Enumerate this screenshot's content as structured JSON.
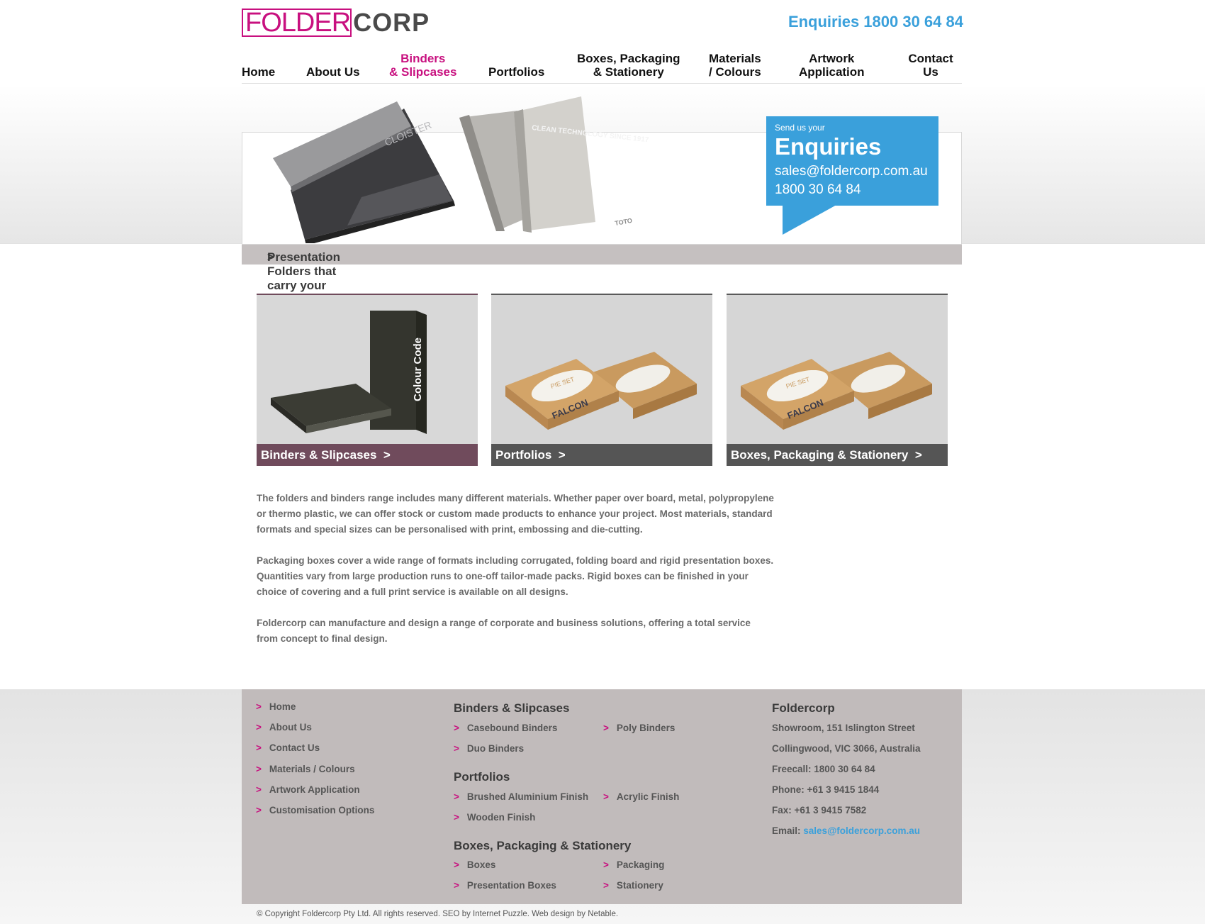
{
  "header": {
    "logo_part1": "FOLDER",
    "logo_part2": "CORP",
    "enquiries": "Enquiries 1800 30 64 84"
  },
  "nav": {
    "home": "Home",
    "about": "About Us",
    "binders_l1": "Binders",
    "binders_l2": "& Slipcases",
    "portfolios": "Portfolios",
    "boxes_l1": "Boxes, Packaging",
    "boxes_l2": "& Stationery",
    "materials_l1": "Materials",
    "materials_l2": "/ Colours",
    "artwork_l1": "Artwork",
    "artwork_l2": "Application",
    "contact": "Contact Us"
  },
  "hero": {
    "enq_small": "Send us your",
    "enq_big": "Enquiries",
    "enq_email": "sales@foldercorp.com.au",
    "enq_phone": "1800 30 64 84",
    "bar_text": "Presentation Folders that carry your corporate brand and style creating the right impression",
    "binder_text": "CLEAN TECHNOLOGY SINCE 1917",
    "binder_brand": "TOTO",
    "folder_brand": "CLOISTER"
  },
  "cards": [
    {
      "label": "Binders & Slipcases",
      "color": "#704b5c",
      "spine_text": "Colour Code"
    },
    {
      "label": "Portfolios",
      "color": "#555555",
      "box_text": "FALCON",
      "lid_text": "PIE SET"
    },
    {
      "label": "Boxes, Packaging & Stationery",
      "color": "#555555",
      "box_text": "FALCON",
      "lid_text": "PIE SET"
    }
  ],
  "body": {
    "p1": "The folders and binders range includes many different materials. Whether paper over board, metal, polypropylene or thermo plastic, we can offer stock or custom made products to enhance your project. Most materials, standard formats and special sizes can be personalised with print, embossing and die-cutting.",
    "p2": "Packaging boxes cover a wide range of formats including corrugated, folding board and rigid presentation boxes. Quantities vary from large production runs to one-off tailor-made packs. Rigid boxes can be finished in your choice of covering and a full print service is available on all designs.",
    "p3": "Foldercorp can manufacture and design a range of corporate and business solutions, offering a total service from concept to final design."
  },
  "footer": {
    "links": [
      "Home",
      "About Us",
      "Contact Us",
      "Materials / Colours",
      "Artwork Application",
      "Customisation Options"
    ],
    "binders_head": "Binders & Slipcases",
    "binders": [
      "Casebound Binders",
      "Poly Binders",
      "Duo Binders"
    ],
    "portfolios_head": "Portfolios",
    "portfolios": [
      "Brushed Aluminium Finish",
      "Acrylic Finish",
      "Wooden Finish"
    ],
    "boxes_head": "Boxes, Packaging & Stationery",
    "boxes": [
      "Boxes",
      "Packaging",
      "Presentation Boxes",
      "Stationery"
    ],
    "company": "Foldercorp",
    "address1": "Showroom, 151 Islington Street",
    "address2": "Collingwood, VIC 3066, Australia",
    "freecall": "Freecall: 1800 30 64 84",
    "phone": "Phone: +61 3 9415 1844",
    "fax": "Fax: +61 3 9415 7582",
    "email_label": "Email:",
    "email": "sales@foldercorp.com.au",
    "chevron": ">",
    "copyright": "© Copyright Foldercorp Pty Ltd. All rights reserved. SEO by Internet Puzzle. Web design by Netable."
  },
  "colors": {
    "brand_magenta": "#c8107f",
    "brand_blue": "#3aa0db",
    "footer_bg": "#c1bbbb"
  }
}
